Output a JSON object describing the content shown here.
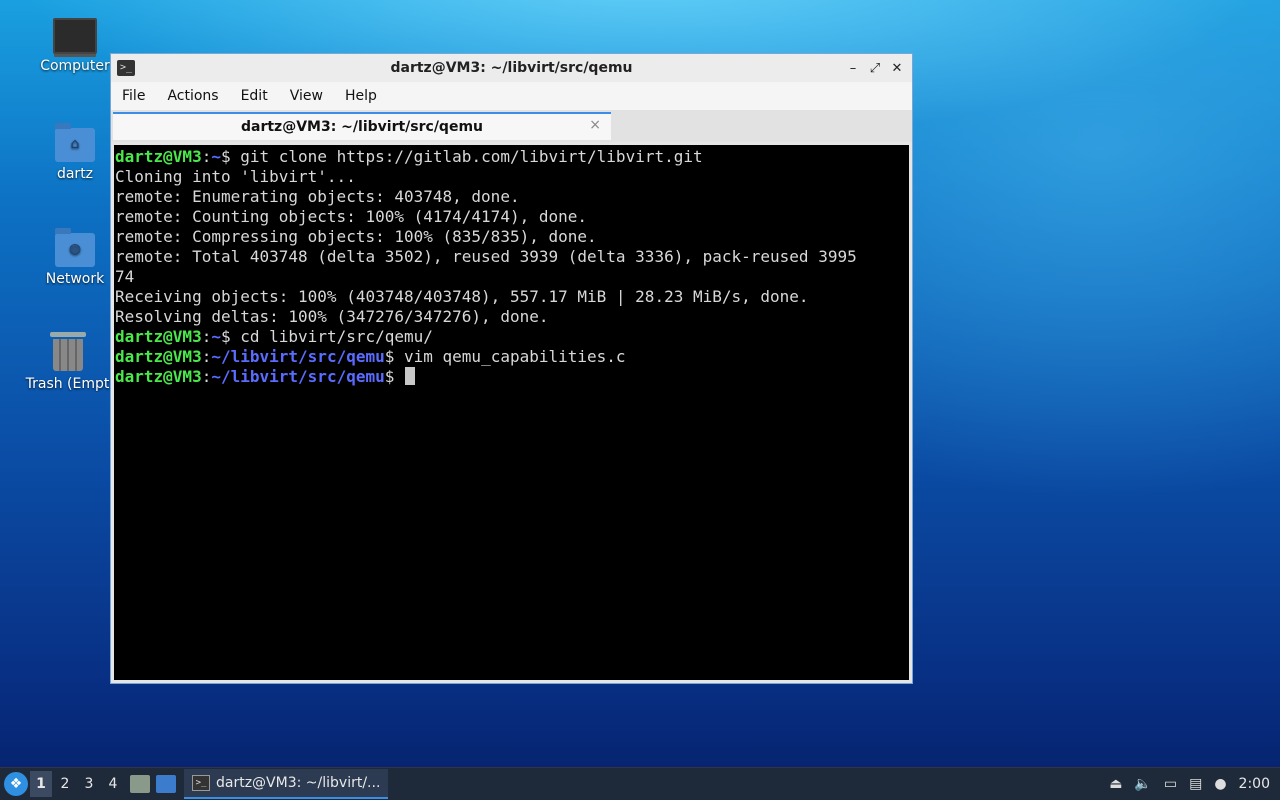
{
  "desktop": {
    "icons": [
      {
        "label": "Computer"
      },
      {
        "label": "dartz"
      },
      {
        "label": "Network"
      },
      {
        "label": "Trash (Empt"
      }
    ]
  },
  "window": {
    "title": "dartz@VM3: ~/libvirt/src/qemu",
    "menus": [
      "File",
      "Actions",
      "Edit",
      "View",
      "Help"
    ],
    "tab_title": "dartz@VM3: ~/libvirt/src/qemu",
    "tab_close": "×",
    "controls": {
      "minimize": "–",
      "maximize": "⤢",
      "close": "✕"
    }
  },
  "terminal": {
    "prompt_user": "dartz@VM3",
    "lines": [
      {
        "type": "prompt",
        "path": "~",
        "cmd": " git clone https://gitlab.com/libvirt/libvirt.git"
      },
      {
        "type": "out",
        "text": "Cloning into 'libvirt'..."
      },
      {
        "type": "out",
        "text": "remote: Enumerating objects: 403748, done."
      },
      {
        "type": "out",
        "text": "remote: Counting objects: 100% (4174/4174), done."
      },
      {
        "type": "out",
        "text": "remote: Compressing objects: 100% (835/835), done."
      },
      {
        "type": "out",
        "text": "remote: Total 403748 (delta 3502), reused 3939 (delta 3336), pack-reused 3995"
      },
      {
        "type": "out",
        "text": "74"
      },
      {
        "type": "out",
        "text": "Receiving objects: 100% (403748/403748), 557.17 MiB | 28.23 MiB/s, done."
      },
      {
        "type": "out",
        "text": "Resolving deltas: 100% (347276/347276), done."
      },
      {
        "type": "prompt",
        "path": "~",
        "cmd": " cd libvirt/src/qemu/"
      },
      {
        "type": "prompt",
        "path": "~/libvirt/src/qemu",
        "cmd": " vim qemu_capabilities.c"
      },
      {
        "type": "prompt",
        "path": "~/libvirt/src/qemu",
        "cmd": " ",
        "cursor": true
      }
    ]
  },
  "taskbar": {
    "workspaces": [
      "1",
      "2",
      "3",
      "4"
    ],
    "active_workspace": "1",
    "task_label": "dartz@VM3: ~/libvirt/...",
    "clock": "2:00"
  }
}
